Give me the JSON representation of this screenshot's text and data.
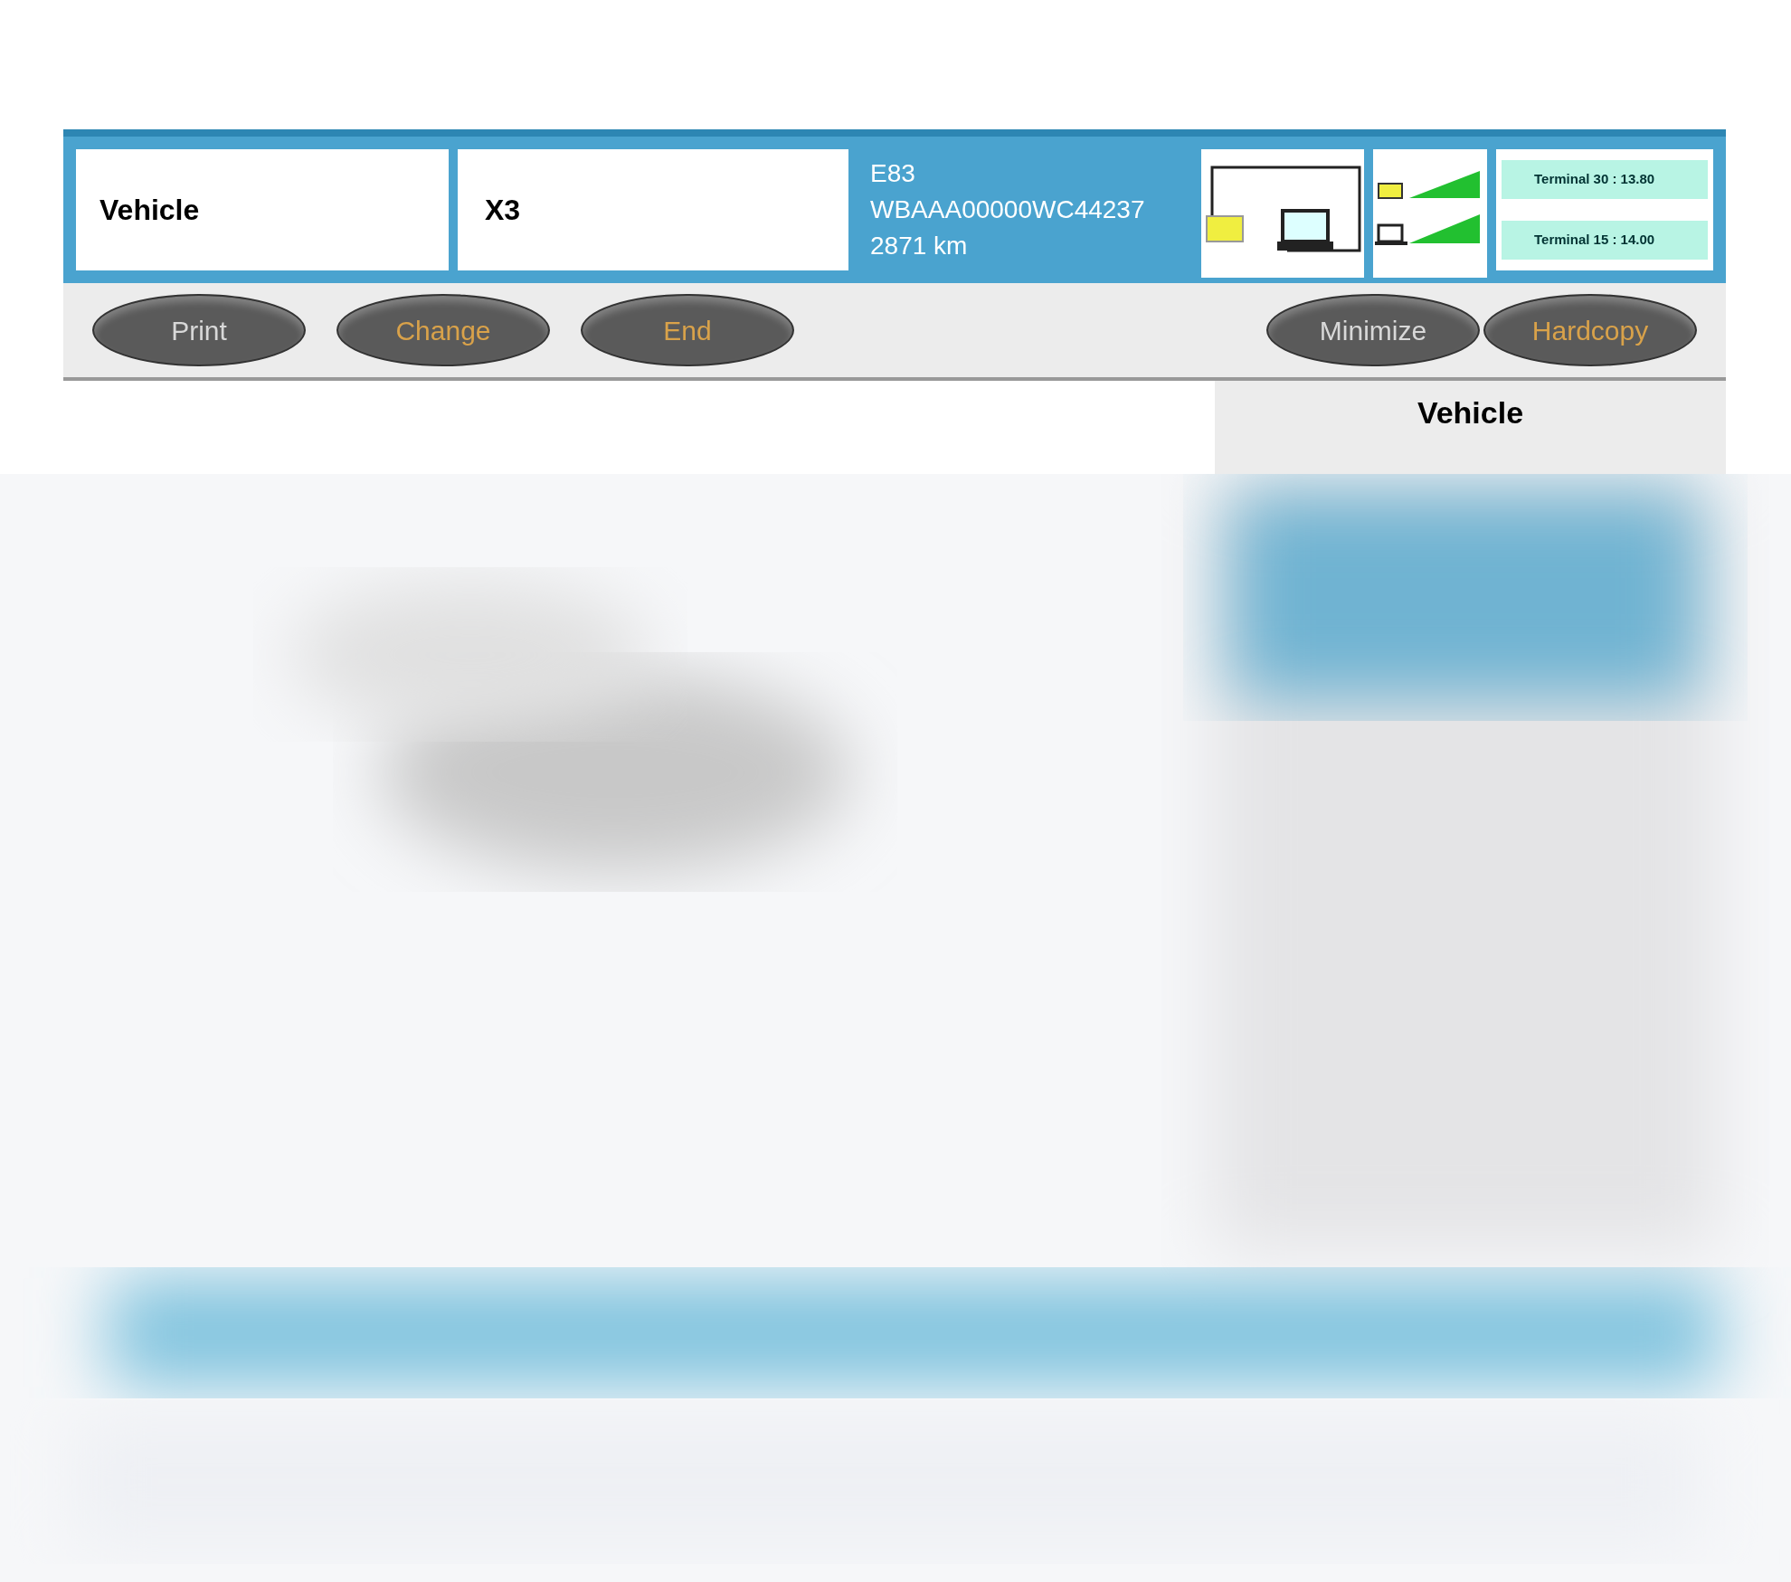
{
  "header": {
    "label": "Vehicle",
    "model": "X3",
    "info": [
      "E83",
      "WBAAA00000WC44237",
      "2871 km"
    ],
    "terminals": [
      "Terminal 30 : 13.80",
      "Terminal 15 : 14.00"
    ]
  },
  "buttons_left": [
    {
      "label": "Print",
      "kind": "plain"
    },
    {
      "label": "Change",
      "kind": "amber"
    },
    {
      "label": "End",
      "kind": "amber"
    }
  ],
  "buttons_right": [
    {
      "label": "Minimize",
      "kind": "plain"
    },
    {
      "label": "Hardcopy",
      "kind": "amber"
    }
  ],
  "side_panel": {
    "title": "Vehicle"
  }
}
